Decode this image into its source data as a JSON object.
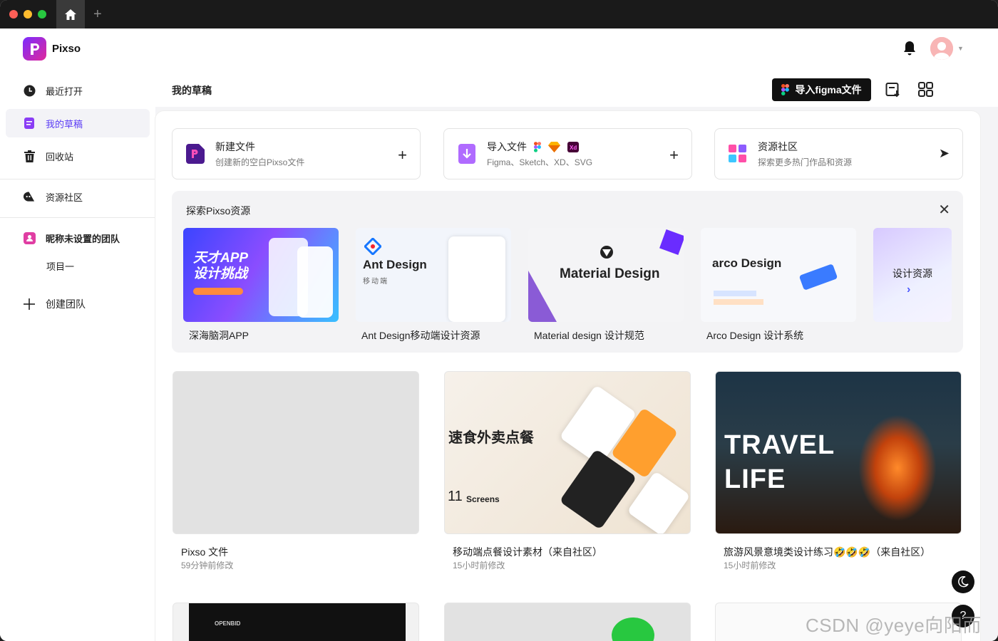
{
  "app": {
    "name": "Pixso"
  },
  "sidebar": {
    "items": [
      {
        "label": "最近打开",
        "icon": "clock-icon"
      },
      {
        "label": "我的草稿",
        "icon": "draft-icon",
        "active": true
      },
      {
        "label": "回收站",
        "icon": "trash-icon"
      },
      {
        "label": "资源社区",
        "icon": "community-icon"
      }
    ],
    "team": {
      "name": "昵称未设置的团队",
      "projects": [
        "项目一"
      ]
    },
    "create_team": "创建团队"
  },
  "header": {
    "title": "我的草稿",
    "import_figma_label": "导入figma文件"
  },
  "actions": [
    {
      "title": "新建文件",
      "subtitle": "创建新的空白Pixso文件",
      "icon": "new-file-icon",
      "right": "+"
    },
    {
      "title": "导入文件",
      "subtitle": "Figma、Sketch、XD、SVG",
      "icon": "import-file-icon",
      "right": "+"
    },
    {
      "title": "资源社区",
      "subtitle": "探索更多热门作品和资源",
      "icon": "resource-community-icon",
      "right": "➤"
    }
  ],
  "explore": {
    "title": "探索Pixso资源",
    "cards": [
      {
        "label": "深海脑洞APP",
        "image_text": "天才APP\n设计挑战"
      },
      {
        "label": "Ant Design移动端设计资源",
        "image_text": "Ant Design",
        "image_sub": "移动端"
      },
      {
        "label": "Material design 设计规范",
        "image_text": "Material Design"
      },
      {
        "label": "Arco Design 设计系统",
        "image_text": "arco Design"
      }
    ],
    "more_label": "设计资源"
  },
  "files": [
    {
      "name": "Pixso 文件",
      "time": "59分钟前修改"
    },
    {
      "name": "移动端点餐设计素材（来自社区）",
      "time": "15小时前修改",
      "image_title": "速食外卖点餐",
      "image_count": "11",
      "image_sub": "Screens"
    },
    {
      "name": "旅游风景意境类设计练习🤣🤣🤣（来自社区）",
      "time": "15小时前修改",
      "image_title": "TRAVEL",
      "image_title2": "LIFE"
    }
  ],
  "files_row2": [
    {
      "image_text": "OPENBID"
    },
    {
      "image_text": ""
    },
    {
      "image_text": ""
    }
  ],
  "watermark": "CSDN @yeye向阳而生"
}
